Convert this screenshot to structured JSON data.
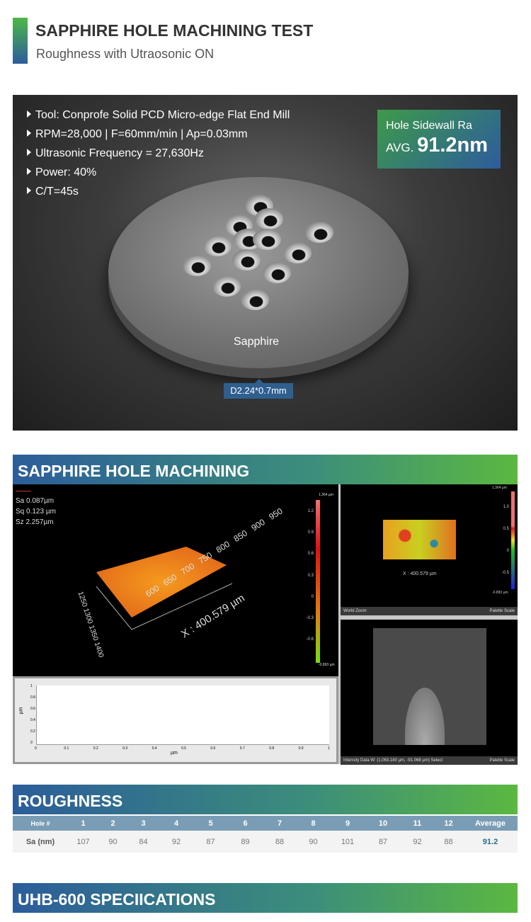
{
  "header": {
    "title": "SAPPHIRE HOLE MACHINING TEST",
    "subtitle": "Roughness with Utraosonic ON",
    "accent_colors": [
      "#4cb848",
      "#2d5c9c"
    ]
  },
  "photo": {
    "specs": [
      "Tool: Conprofe Solid PCD Micro-edge Flat End Mill",
      "RPM=28,000 | F=60mm/min | Ap=0.03mm",
      "Ultrasonic Frequency = 27,630Hz",
      "Power: 40%",
      "C/T=45s"
    ],
    "badge": {
      "label": "Hole Sidewall Ra",
      "prefix": "AVG.",
      "value": "91.2nm"
    },
    "material_label": "Sapphire",
    "dimension_tag": "D2.24*0.7mm"
  },
  "machining": {
    "title": "SAPPHIRE HOLE MACHINING",
    "view3d": {
      "stats": [
        "Sa 0.087µm",
        "Sq 0.123 µm",
        "Sz 2.257µm"
      ],
      "x_ticks": [
        "600",
        "650",
        "700",
        "750",
        "800",
        "850",
        "900",
        "950"
      ],
      "x_label": "X : 400.579 µm",
      "y_ticks": "1250 1300 1350 1400",
      "scale_max": "1.364 µm",
      "scale_min": "-0.893 µm",
      "scale_ticks": [
        "1.2",
        "0.9",
        "0.6",
        "0.3",
        "0",
        "-0.3",
        "-0.6"
      ]
    },
    "profile": {
      "y_ticks": [
        "1",
        "0.8",
        "0.6",
        "0.4",
        "0.2",
        "0"
      ],
      "x_ticks": [
        "0",
        "0.1",
        "0.2",
        "0.3",
        "0.4",
        "0.5",
        "0.6",
        "0.7",
        "0.8",
        "0.9",
        "1"
      ],
      "y_label": "µm",
      "x_label": "µm"
    },
    "view2d": {
      "x_label": "X : 400.579 µm",
      "scale_max": "1.364 µm",
      "scale_min": "-0.893 µm",
      "scale_ticks": [
        "1.0",
        "0.5",
        "0",
        "-0.5"
      ],
      "status_left": "World   Zoom",
      "status_right": "Palette Scale"
    },
    "intensity": {
      "status_left": "Intensity Data   W: (1,063.180 µm, -91.068 µm)   Select",
      "status_right": "Palette Scale"
    }
  },
  "roughness": {
    "title": "ROUGHNESS",
    "headers": [
      "Hole #",
      "1",
      "2",
      "3",
      "4",
      "5",
      "6",
      "7",
      "8",
      "9",
      "10",
      "11",
      "12",
      "Average"
    ],
    "row": [
      "Sa (nm)",
      "107",
      "90",
      "84",
      "92",
      "87",
      "89",
      "88",
      "90",
      "101",
      "87",
      "92",
      "88",
      "91.2"
    ],
    "average_color": "#1f6f8f"
  },
  "specs_section": {
    "title": "UHB-600 SPECIICATIONS"
  }
}
